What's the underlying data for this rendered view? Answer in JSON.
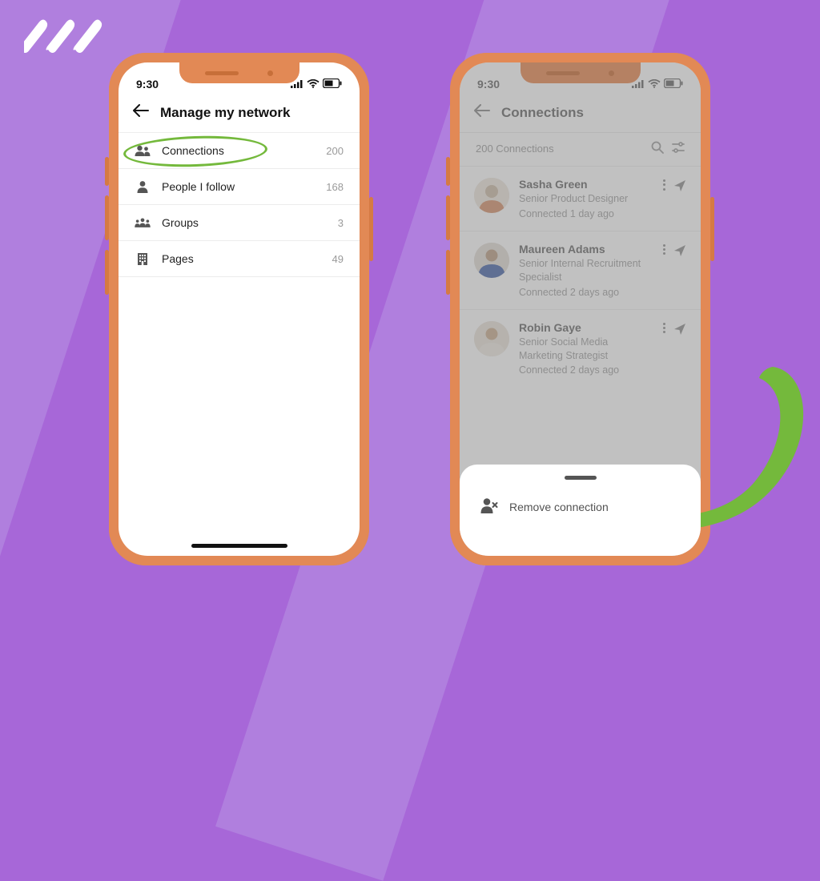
{
  "status": {
    "time": "9:30"
  },
  "phone1": {
    "header_title": "Manage my network",
    "rows": [
      {
        "label": "Connections",
        "count": "200"
      },
      {
        "label": "People I follow",
        "count": "168"
      },
      {
        "label": "Groups",
        "count": "3"
      },
      {
        "label": "Pages",
        "count": "49"
      }
    ]
  },
  "phone2": {
    "header_title": "Connections",
    "sub_header": "200 Connections",
    "connections": [
      {
        "name": "Sasha Green",
        "title": "Senior Product Designer",
        "connected": "Connected 1 day ago"
      },
      {
        "name": "Maureen Adams",
        "title": "Senior Internal Recruitment Specialist",
        "connected": "Connected 2 days ago"
      },
      {
        "name": "Robin Gaye",
        "title": "Senior Social Media Marketing Strategist",
        "connected": "Connected 2 days ago"
      }
    ],
    "sheet_action": "Remove connection"
  }
}
